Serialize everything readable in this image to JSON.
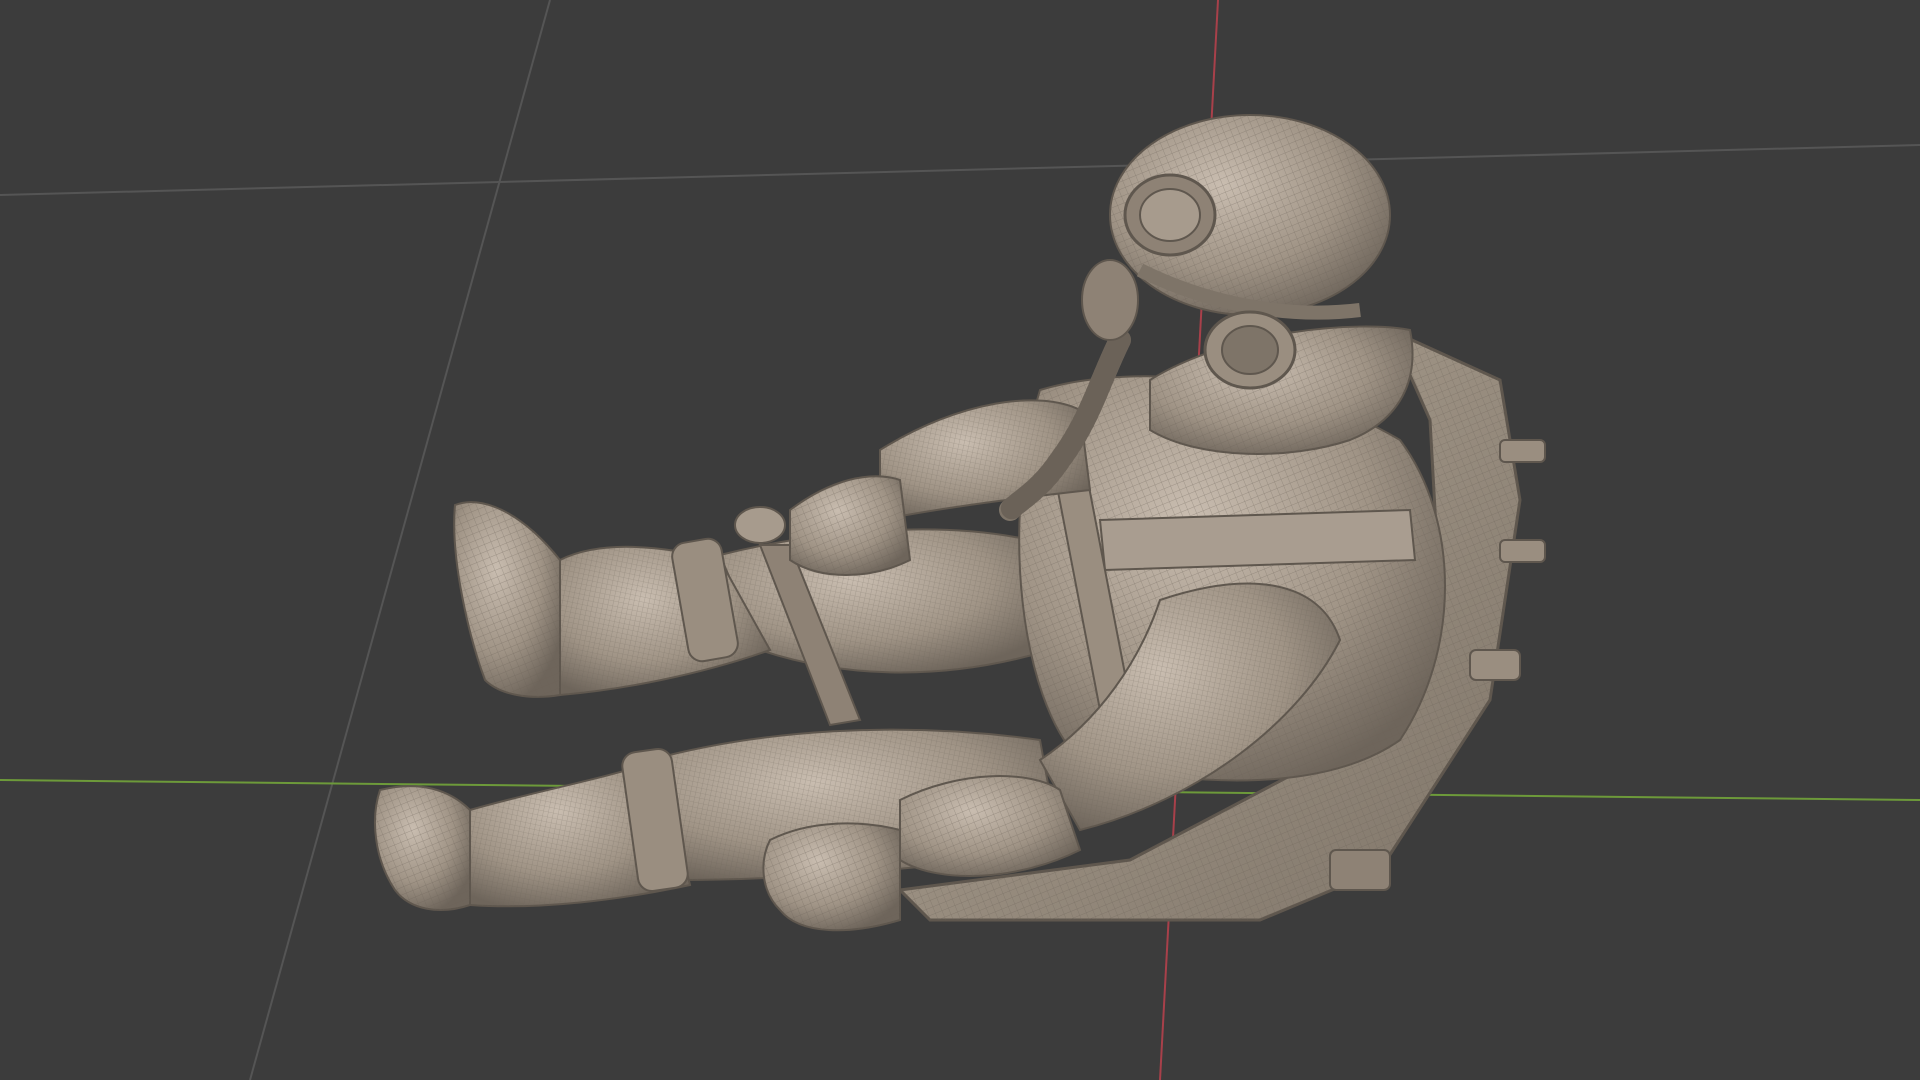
{
  "viewport": {
    "view": "3d-viewport",
    "shading": "solid-wireframe-overlay",
    "background_color": "#3c3c3c",
    "grid_color": "#555555",
    "x_axis_color": "#6d9a3a",
    "y_axis_color": "#a8404a"
  },
  "model": {
    "subject": "seated-pilot-with-ejection-seat",
    "base_color": "#a09486",
    "shadow_color": "#6e655b",
    "highlight_color": "#c9bdb0",
    "wire_color": "#6a6158"
  }
}
